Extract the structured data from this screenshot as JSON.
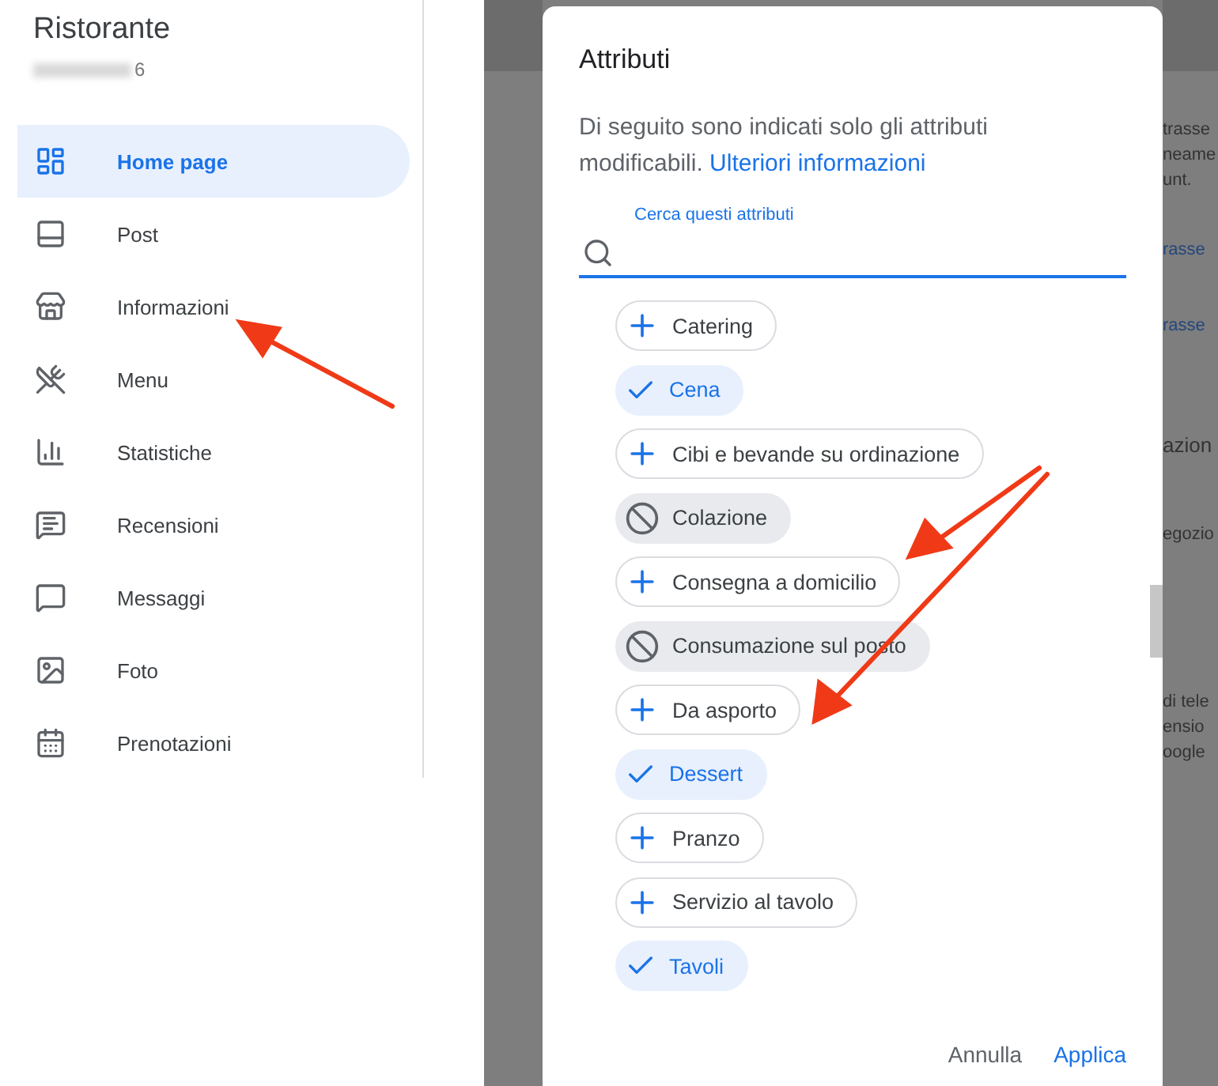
{
  "business": {
    "name": "Ristorante",
    "address_end": "6"
  },
  "sidebar": {
    "items": [
      {
        "label": "Home page",
        "selected": true
      },
      {
        "label": "Post",
        "selected": false
      },
      {
        "label": "Informazioni",
        "selected": false
      },
      {
        "label": "Menu",
        "selected": false
      },
      {
        "label": "Statistiche",
        "selected": false
      },
      {
        "label": "Recensioni",
        "selected": false
      },
      {
        "label": "Messaggi",
        "selected": false
      },
      {
        "label": "Foto",
        "selected": false
      },
      {
        "label": "Prenotazioni",
        "selected": false
      }
    ]
  },
  "background_fragments": [
    {
      "text": "trasse",
      "kind": "text"
    },
    {
      "text": "neame",
      "kind": "text"
    },
    {
      "text": "unt.",
      "kind": "text"
    },
    {
      "text": "rasse",
      "kind": "link"
    },
    {
      "text": "rasse",
      "kind": "link"
    },
    {
      "text": "azion",
      "kind": "heading"
    },
    {
      "text": "egozio",
      "kind": "text"
    },
    {
      "text": "di tele",
      "kind": "text"
    },
    {
      "text": "ensio",
      "kind": "text"
    },
    {
      "text": "oogle",
      "kind": "text"
    }
  ],
  "dialog": {
    "title": "Attributi",
    "description": "Di seguito sono indicati solo gli attributi modificabili.",
    "link": "Ulteriori informazioni",
    "search": {
      "label": "Cerca questi attributi"
    },
    "chips": [
      {
        "label": "Catering",
        "kind": "add"
      },
      {
        "label": "Cena",
        "kind": "selected"
      },
      {
        "label": "Cibi e bevande su ordinazione",
        "kind": "add"
      },
      {
        "label": "Colazione",
        "kind": "excluded"
      },
      {
        "label": "Consegna a domicilio",
        "kind": "add"
      },
      {
        "label": "Consumazione sul posto",
        "kind": "excluded"
      },
      {
        "label": "Da asporto",
        "kind": "add"
      },
      {
        "label": "Dessert",
        "kind": "selected"
      },
      {
        "label": "Pranzo",
        "kind": "add"
      },
      {
        "label": "Servizio al tavolo",
        "kind": "add"
      },
      {
        "label": "Tavoli",
        "kind": "selected"
      }
    ],
    "buttons": [
      {
        "label": "Annulla",
        "kind": "secondary"
      },
      {
        "label": "Applica",
        "kind": "primary"
      }
    ]
  }
}
